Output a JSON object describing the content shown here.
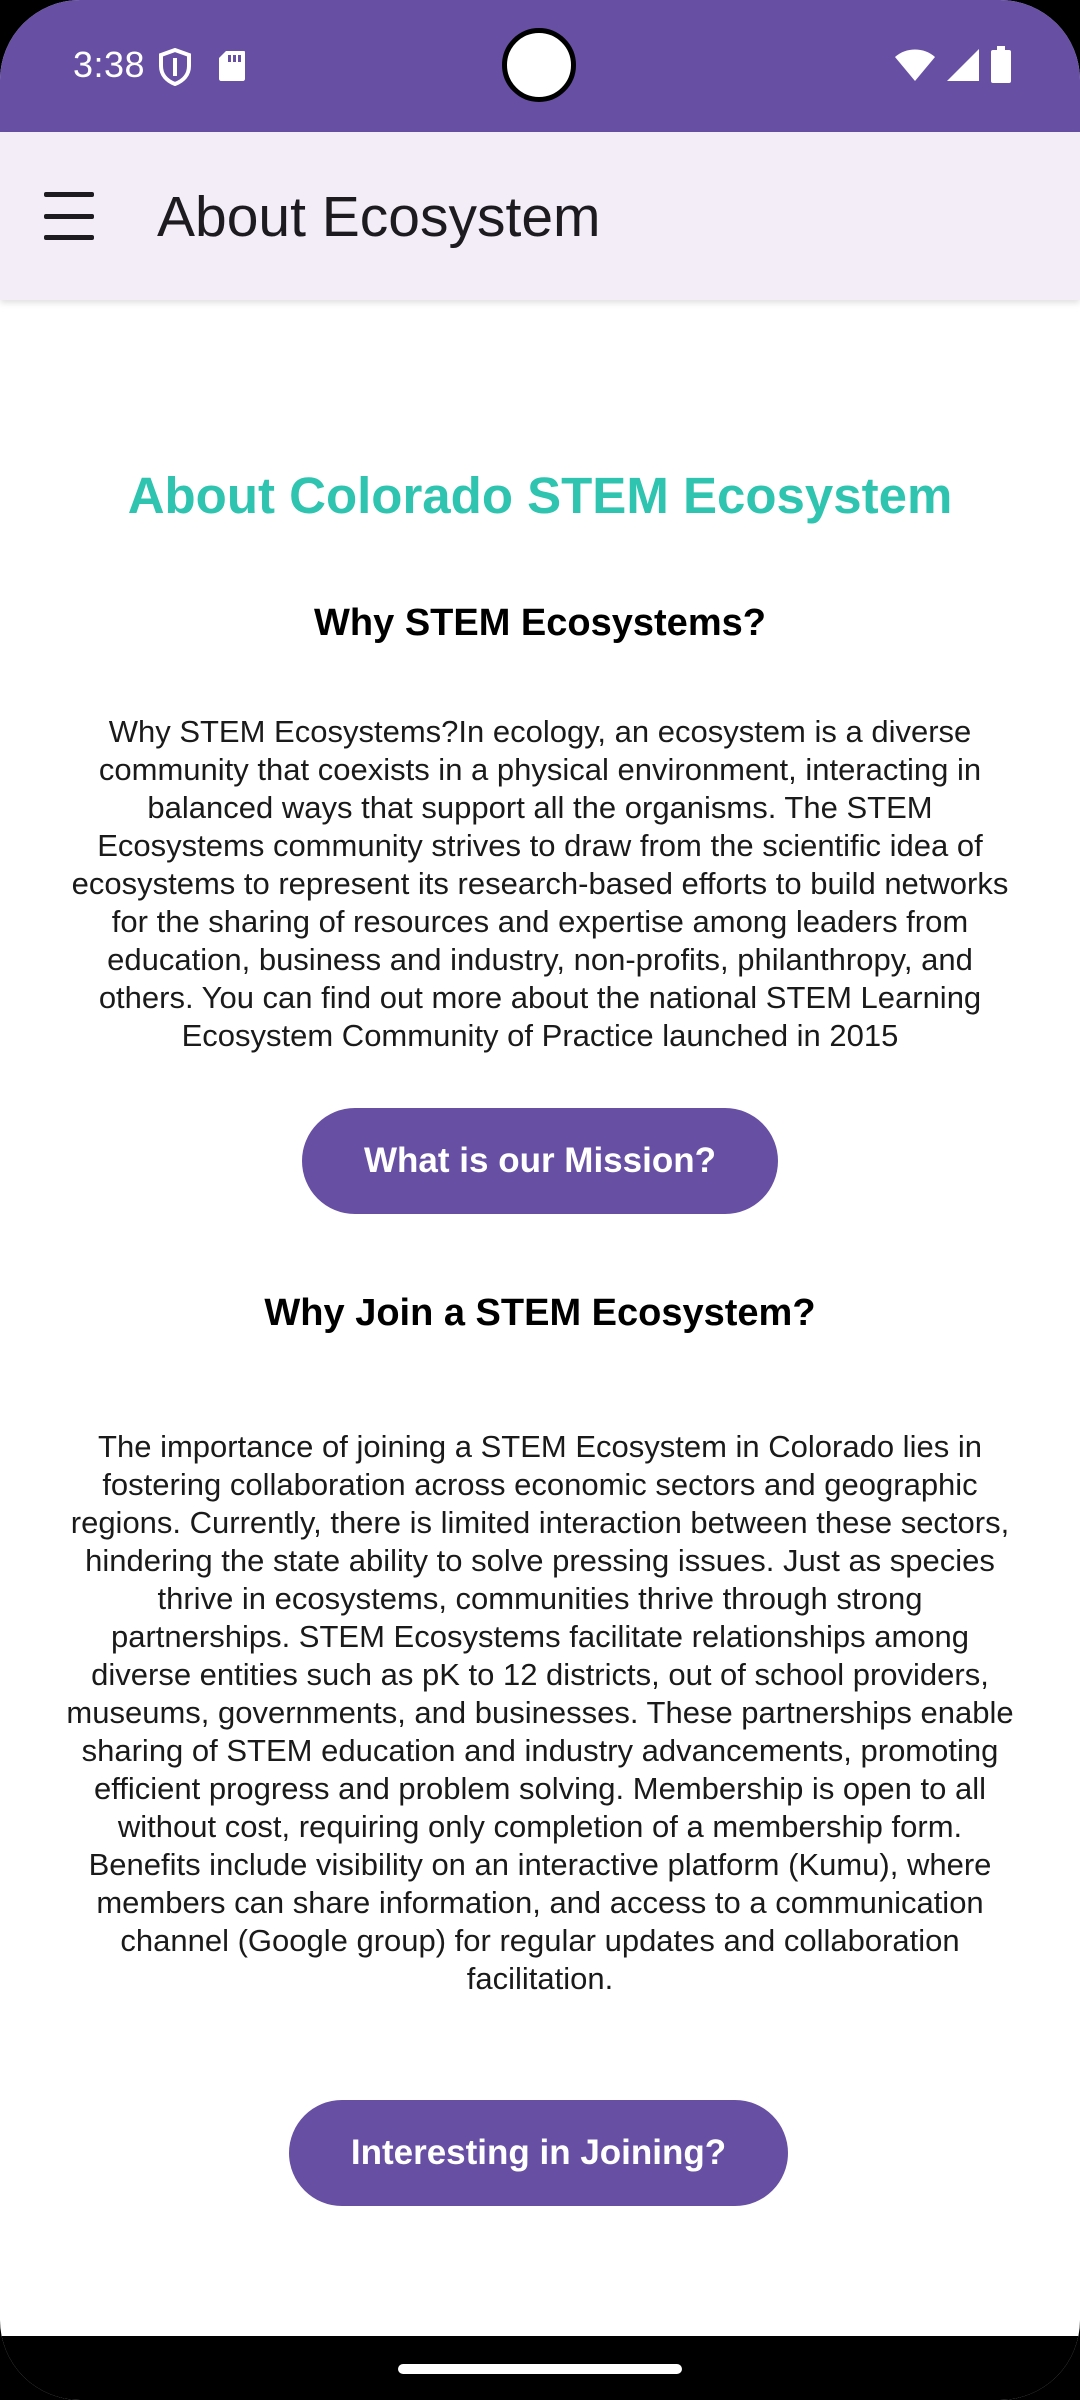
{
  "status_bar": {
    "time": "3:38",
    "icons": [
      "shield-icon",
      "sd-card-icon",
      "wifi-icon",
      "cell-signal-icon",
      "battery-icon"
    ]
  },
  "app_bar": {
    "title": "About Ecosystem",
    "menu_icon": "hamburger-menu-icon"
  },
  "main": {
    "title": "About Colorado STEM Ecosystem",
    "section1": {
      "heading": "Why STEM Ecosystems?",
      "body": "Why STEM Ecosystems?In ecology, an ecosystem is a diverse community that coexists in a physical environment, interacting in balanced ways that support all the organisms. The STEM Ecosystems community strives to draw from the scientific idea of ecosystems to represent its research-based efforts to build networks for the sharing of resources and expertise among leaders from education, business and industry, non-profits, philanthropy, and others. You can find out more about the national STEM Learning Ecosystem Community of Practice launched in 2015",
      "button_label": "What is our Mission?"
    },
    "section2": {
      "heading": "Why Join a STEM Ecosystem?",
      "body": "The importance of joining a STEM Ecosystem in Colorado lies in fostering collaboration across economic sectors and geographic regions. Currently, there is limited interaction between these sectors, hindering the state ability to solve pressing issues. Just as species thrive in ecosystems, communities thrive through strong partnerships. STEM Ecosystems facilitate relationships among diverse entities such as pK to 12 districts, out of school providers, museums, governments, and businesses. These partnerships enable sharing of STEM education and industry advancements, promoting efficient progress and problem solving. Membership is open to all without cost, requiring only completion of a membership form. Benefits include visibility on an interactive platform (Kumu), where members can share information, and access to a communication channel (Google group) for regular updates and collaboration facilitation.",
      "button_label": "Interesting in Joining?"
    }
  },
  "colors": {
    "primary": "#6750a4",
    "app_bar_bg": "#f3edf7",
    "title_accent": "#2ec4b0"
  }
}
